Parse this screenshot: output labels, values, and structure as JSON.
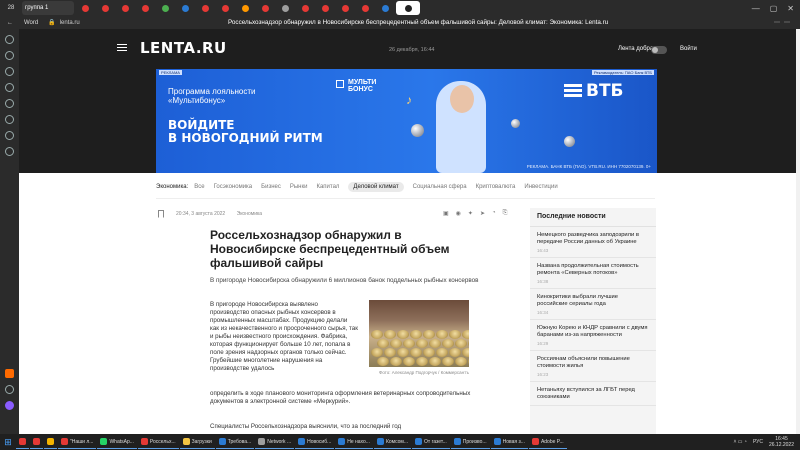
{
  "browser": {
    "group_tab_label": "группа 1",
    "back_label": "Word",
    "address_domain": "lenta.ru",
    "page_title": "Россельхознадзор обнаружил в Новосибирске беспрецедентный объем фальшивой сайры: Деловой климат: Экономика: Lenta.ru",
    "tab_colors": [
      "#e53935",
      "#e53935",
      "#e53935",
      "#e53935",
      "#4caf50",
      "#2b7bd3",
      "#e53935",
      "#e53935",
      "#ff9800",
      "#e53935",
      "#9e9e9e",
      "#e53935",
      "#e53935",
      "#e53935",
      "#e53935",
      "#2b7bd3"
    ]
  },
  "header": {
    "logo": "LENTA.RU",
    "date": "26 декабря, 16:44",
    "good_tape_label": "Лента добра",
    "login_label": "Войти"
  },
  "banner": {
    "ad_label_left": "РЕКЛАМА",
    "ad_label_right": "Рекламодатель: ПАО Банк ВТБ",
    "loyalty_line1": "Программа лояльности",
    "loyalty_line2": "«Мультибонус»",
    "slogan_line1": "ВОЙДИТЕ",
    "slogan_line2": "В НОВОГОДНИЙ РИТМ",
    "multibonus_line1": "МУЛЬТИ",
    "multibonus_line2": "БОНУС",
    "bank_name": "ВТБ",
    "legal": "РЕКЛАМА. БАНК ВТБ (ПАО). VTB.RU. ИНН 7702070139. 0+"
  },
  "rubrics": {
    "lead": "Экономика:",
    "items": [
      "Все",
      "Госэкономика",
      "Бизнес",
      "Рынки",
      "Капитал",
      "Деловой климат",
      "Социальная сфера",
      "Криптовалюта",
      "Инвестиции"
    ],
    "active_index": 5
  },
  "article": {
    "time": "20:34, 3 августа 2022",
    "rubric": "Экономика",
    "headline": "Россельхознадзор обнаружил в Новосибирске беспрецедентный объем фальшивой сайры",
    "lede": "В пригороде Новосибирска обнаружили 6 миллионов банок поддельных рыбных консервов",
    "body1": "В пригороде Новосибирска выявлено производство опасных рыбных консервов в промышленных масштабах. Продукцию делали как из некачественного и просроченного сырья, так и рыбы неизвестного происхождения. Фабрика, которая функционирует больше 10 лет, попала в поле зрения надзорных органов только сейчас. Грубейшие многолетние нарушения на производстве удалось",
    "body2": "определить в ходе планового мониторинга оформления ветеринарных сопроводительных документов в электронной системе «Меркурий».",
    "body3": "Специалисты Россельхознадзора выяснили, что за последний год",
    "photo_caption": "Фото: Александр Подгорчук / Коммерсантъ",
    "share_icons": [
      "▣",
      "◉",
      "✦",
      "➤",
      "◔",
      "⎘"
    ]
  },
  "latest": {
    "title": "Последние новости",
    "items": [
      {
        "title": "Немецкого разведчика заподозрили в передаче России данных об Украине",
        "time": "16:43"
      },
      {
        "title": "Названа продолжительная стоимость ремонта «Северных потоков»",
        "time": "16:38"
      },
      {
        "title": "Кинокритики выбрали лучшие российские сериалы года",
        "time": "16:34"
      },
      {
        "title": "Южную Корею и КНДР сравнили с двумя баранами из-за напряженности",
        "time": "16:29"
      },
      {
        "title": "Россиянам объяснили повышение стоимости жилья",
        "time": "16:23"
      },
      {
        "title": "Нетаньяху вступился за ЛГБТ перед союзниками",
        "time": ""
      }
    ]
  },
  "taskbar": {
    "items": [
      {
        "label": "",
        "color": "#e53935"
      },
      {
        "label": "",
        "color": "#e53935"
      },
      {
        "label": "",
        "color": "#f4b400"
      },
      {
        "label": "\"Наши л...",
        "color": "#e53935"
      },
      {
        "label": "WhatsAp...",
        "color": "#25d366"
      },
      {
        "label": "Россельх...",
        "color": "#e53935"
      },
      {
        "label": "Загрузки",
        "color": "#f4c542"
      },
      {
        "label": "Требова...",
        "color": "#2b7bd3"
      },
      {
        "label": "Network ...",
        "color": "#9e9e9e"
      },
      {
        "label": "Новосиб...",
        "color": "#2b7bd3"
      },
      {
        "label": "Не нахо...",
        "color": "#2b7bd3"
      },
      {
        "label": "Комсом...",
        "color": "#2b7bd3"
      },
      {
        "label": "От газет...",
        "color": "#2b7bd3"
      },
      {
        "label": "Произво...",
        "color": "#2b7bd3"
      },
      {
        "label": "Новая з...",
        "color": "#2b7bd3"
      },
      {
        "label": "Adobe P...",
        "color": "#e53935"
      }
    ],
    "lang": "РУС",
    "time": "16:45",
    "date": "26.12.2022"
  }
}
